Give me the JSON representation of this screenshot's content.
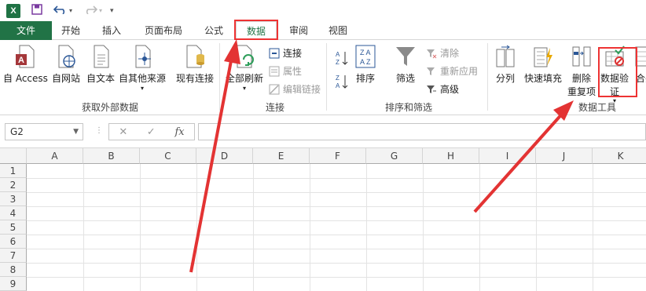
{
  "qat": {
    "app_icon": "X",
    "save_icon": "save-icon",
    "undo_icon": "undo-icon",
    "redo_icon": "redo-icon"
  },
  "tabs": [
    {
      "label": "文件"
    },
    {
      "label": "开始"
    },
    {
      "label": "插入"
    },
    {
      "label": "页面布局"
    },
    {
      "label": "公式"
    },
    {
      "label": "数据"
    },
    {
      "label": "审阅"
    },
    {
      "label": "视图"
    }
  ],
  "ribbon": {
    "get_external": {
      "label": "获取外部数据",
      "access": "自 Access",
      "web": "自网站",
      "text": "自文本",
      "other": "自其他来源",
      "existing": "现有连接"
    },
    "connections": {
      "label": "连接",
      "refresh": "全部刷新",
      "connections": "连接",
      "properties": "属性",
      "edit_links": "编辑链接"
    },
    "sort_filter": {
      "label": "排序和筛选",
      "sort": "排序",
      "filter": "筛选",
      "clear": "清除",
      "reapply": "重新应用",
      "advanced": "高级"
    },
    "data_tools": {
      "label": "数据工具",
      "text_to_columns": "分列",
      "flash_fill": "快速填充",
      "remove_dup_line1": "删除",
      "remove_dup_line2": "重复项",
      "validation_line1": "数据验",
      "validation_line2": "证",
      "consolidate": "合并"
    }
  },
  "formula_bar": {
    "name_box": "G2",
    "fx": "fx",
    "value": ""
  },
  "columns": [
    "A",
    "B",
    "C",
    "D",
    "E",
    "F",
    "G",
    "H",
    "I",
    "J",
    "K"
  ],
  "rows": [
    "1",
    "2",
    "3",
    "4",
    "5",
    "6",
    "7",
    "8",
    "9"
  ],
  "colors": {
    "excel_green": "#217346",
    "highlight_red": "#e33333"
  }
}
